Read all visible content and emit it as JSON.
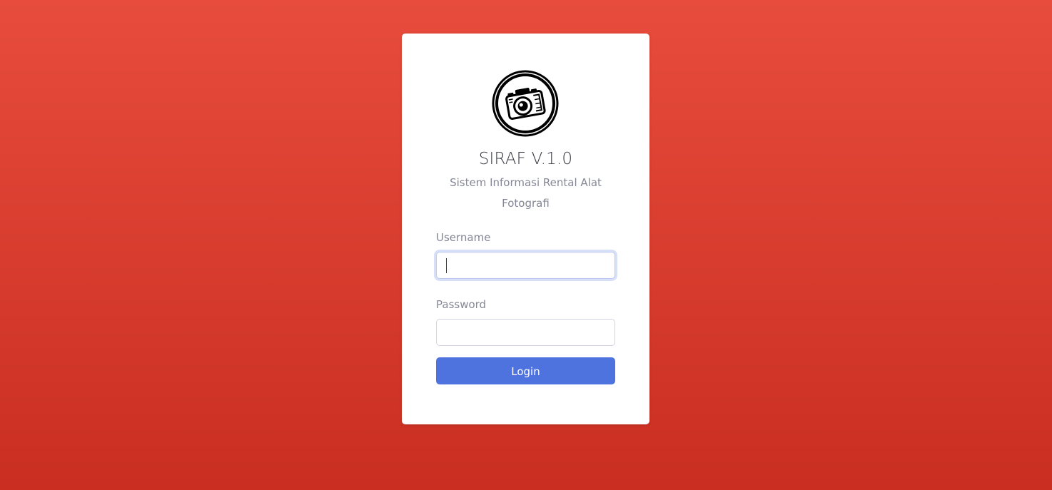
{
  "app": {
    "title": "SIRAF V.1.0",
    "subtitle": "Sistem Informasi Rental Alat Fotografi",
    "logo_icon": "camera-icon"
  },
  "form": {
    "username_label": "Username",
    "username_value": "",
    "password_label": "Password",
    "password_value": "",
    "login_label": "Login"
  },
  "colors": {
    "background_top": "#e74c3c",
    "background_bottom": "#c92e21",
    "primary": "#4e73df",
    "card": "#ffffff"
  }
}
